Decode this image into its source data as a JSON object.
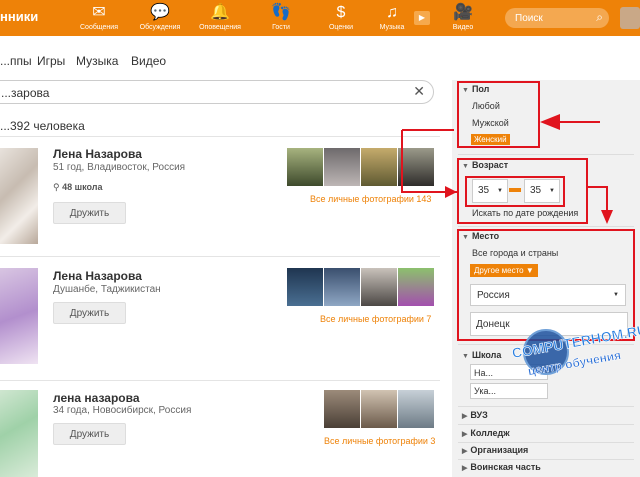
{
  "topbar": {
    "brand": "нники",
    "nav": [
      {
        "label": "Сообщения",
        "icon": "envelope-icon"
      },
      {
        "label": "Обсуждения",
        "icon": "chat-icon"
      },
      {
        "label": "Оповещения",
        "icon": "bell-icon"
      },
      {
        "label": "Гости",
        "icon": "footprints-icon"
      },
      {
        "label": "Оценки",
        "icon": "dollar-icon"
      },
      {
        "label": "Музыка",
        "icon": "music-note-icon"
      },
      {
        "label": "Видео",
        "icon": "video-camera-icon"
      }
    ],
    "search_placeholder": "Поиск",
    "accent_color": "#ee8208"
  },
  "tabs": [
    "...ппы",
    "Игры",
    "Музыка",
    "Видео"
  ],
  "search": {
    "value": "...зарова"
  },
  "results_count": "...392 человека",
  "results": [
    {
      "name": "Лена Назарова",
      "info": "51 год, Владивосток, Россия",
      "school": "48 школа",
      "button": "Дружить",
      "photos_link": "Все личные фотографии 143"
    },
    {
      "name": "Лена Назарова",
      "info": "Душанбе, Таджикистан",
      "school": "",
      "button": "Дружить",
      "photos_link": "Все личные фотографии 7"
    },
    {
      "name": "лена назарова",
      "info": "34 года, Новосибирск, Россия",
      "school": "",
      "button": "Дружить",
      "photos_link": "Все личные фотографии 3"
    }
  ],
  "filters": {
    "gender": {
      "title": "Пол",
      "options": [
        "Любой",
        "Мужской",
        "Женский"
      ],
      "selected": "Женский"
    },
    "age": {
      "title": "Возраст",
      "from": "35",
      "to": "35",
      "birthdate_link": "Искать по дате рождения"
    },
    "place": {
      "title": "Место",
      "all": "Все города и страны",
      "other_button": "Другое место ▼",
      "country": "Россия",
      "city": "Донецк"
    },
    "school": {
      "title": "Школа",
      "input_value": "На...",
      "input2_value": "Ука..."
    },
    "collapsed": [
      "ВУЗ",
      "Колледж",
      "Организация",
      "Воинская часть"
    ]
  },
  "watermark": {
    "line1": "COMPUTERHOM.RU",
    "line2": "центр обучения"
  }
}
